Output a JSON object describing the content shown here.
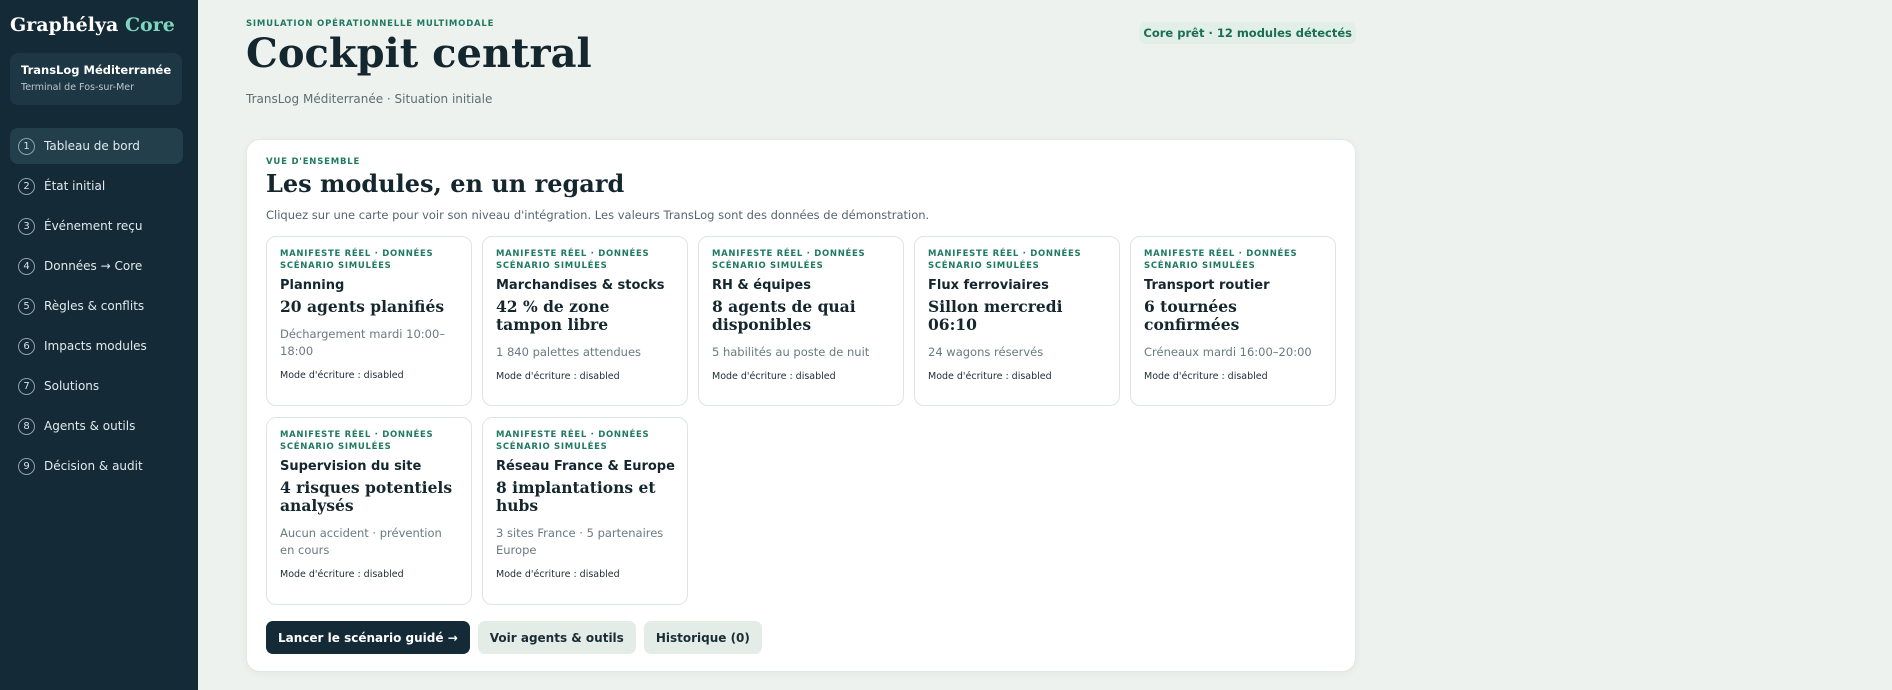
{
  "sidebar": {
    "brand_name": "Graphélya",
    "brand_accent": "Core",
    "org": {
      "name": "TransLog Méditerranée",
      "site": "Terminal de Fos-sur-Mer"
    },
    "items": [
      {
        "num": "1",
        "label": "Tableau de bord",
        "active": true
      },
      {
        "num": "2",
        "label": "État initial"
      },
      {
        "num": "3",
        "label": "Événement reçu"
      },
      {
        "num": "4",
        "label": "Données → Core"
      },
      {
        "num": "5",
        "label": "Règles & conflits"
      },
      {
        "num": "6",
        "label": "Impacts modules"
      },
      {
        "num": "7",
        "label": "Solutions"
      },
      {
        "num": "8",
        "label": "Agents & outils"
      },
      {
        "num": "9",
        "label": "Décision & audit"
      }
    ]
  },
  "header": {
    "eyebrow": "SIMULATION OPÉRATIONNELLE MULTIMODALE",
    "title": "Cockpit central",
    "subtitle": "TransLog Méditerranée · Situation initiale",
    "status": "Core prêt · 12 modules détectés"
  },
  "overview": {
    "eyebrow": "VUE D'ENSEMBLE",
    "title": "Les modules, en un regard",
    "description": "Cliquez sur une carte pour voir son niveau d'intégration. Les valeurs TransLog sont des données de démonstration.",
    "cards": [
      {
        "tag": "MANIFESTE RÉEL · DONNÉES SCÉNARIO SIMULÉES",
        "name": "Planning",
        "value": "20 agents planifiés",
        "detail": "Déchargement mardi 10:00–18:00",
        "mode": "Mode d'écriture : disabled"
      },
      {
        "tag": "MANIFESTE RÉEL · DONNÉES SCÉNARIO SIMULÉES",
        "name": "Marchandises & stocks",
        "value": "42 % de zone tampon libre",
        "detail": "1 840 palettes attendues",
        "mode": "Mode d'écriture : disabled"
      },
      {
        "tag": "MANIFESTE RÉEL · DONNÉES SCÉNARIO SIMULÉES",
        "name": "RH & équipes",
        "value": "8 agents de quai disponibles",
        "detail": "5 habilités au poste de nuit",
        "mode": "Mode d'écriture : disabled"
      },
      {
        "tag": "MANIFESTE RÉEL · DONNÉES SCÉNARIO SIMULÉES",
        "name": "Flux ferroviaires",
        "value": "Sillon mercredi 06:10",
        "detail": "24 wagons réservés",
        "mode": "Mode d'écriture : disabled"
      },
      {
        "tag": "MANIFESTE RÉEL · DONNÉES SCÉNARIO SIMULÉES",
        "name": "Transport routier",
        "value": "6 tournées confirmées",
        "detail": "Créneaux mardi 16:00–20:00",
        "mode": "Mode d'écriture : disabled"
      },
      {
        "tag": "MANIFESTE RÉEL · DONNÉES SCÉNARIO SIMULÉES",
        "name": "Supervision du site",
        "value": "4 risques potentiels analysés",
        "detail": "Aucun accident · prévention en cours",
        "mode": "Mode d'écriture : disabled"
      },
      {
        "tag": "MANIFESTE RÉEL · DONNÉES SCÉNARIO SIMULÉES",
        "name": "Réseau France & Europe",
        "value": "8 implantations et hubs",
        "detail": "3 sites France · 5 partenaires Europe",
        "mode": "Mode d'écriture : disabled"
      }
    ]
  },
  "actions": {
    "primary": "Lancer le scénario guidé →",
    "agents": "Voir agents & outils",
    "history": "Historique (0)"
  }
}
